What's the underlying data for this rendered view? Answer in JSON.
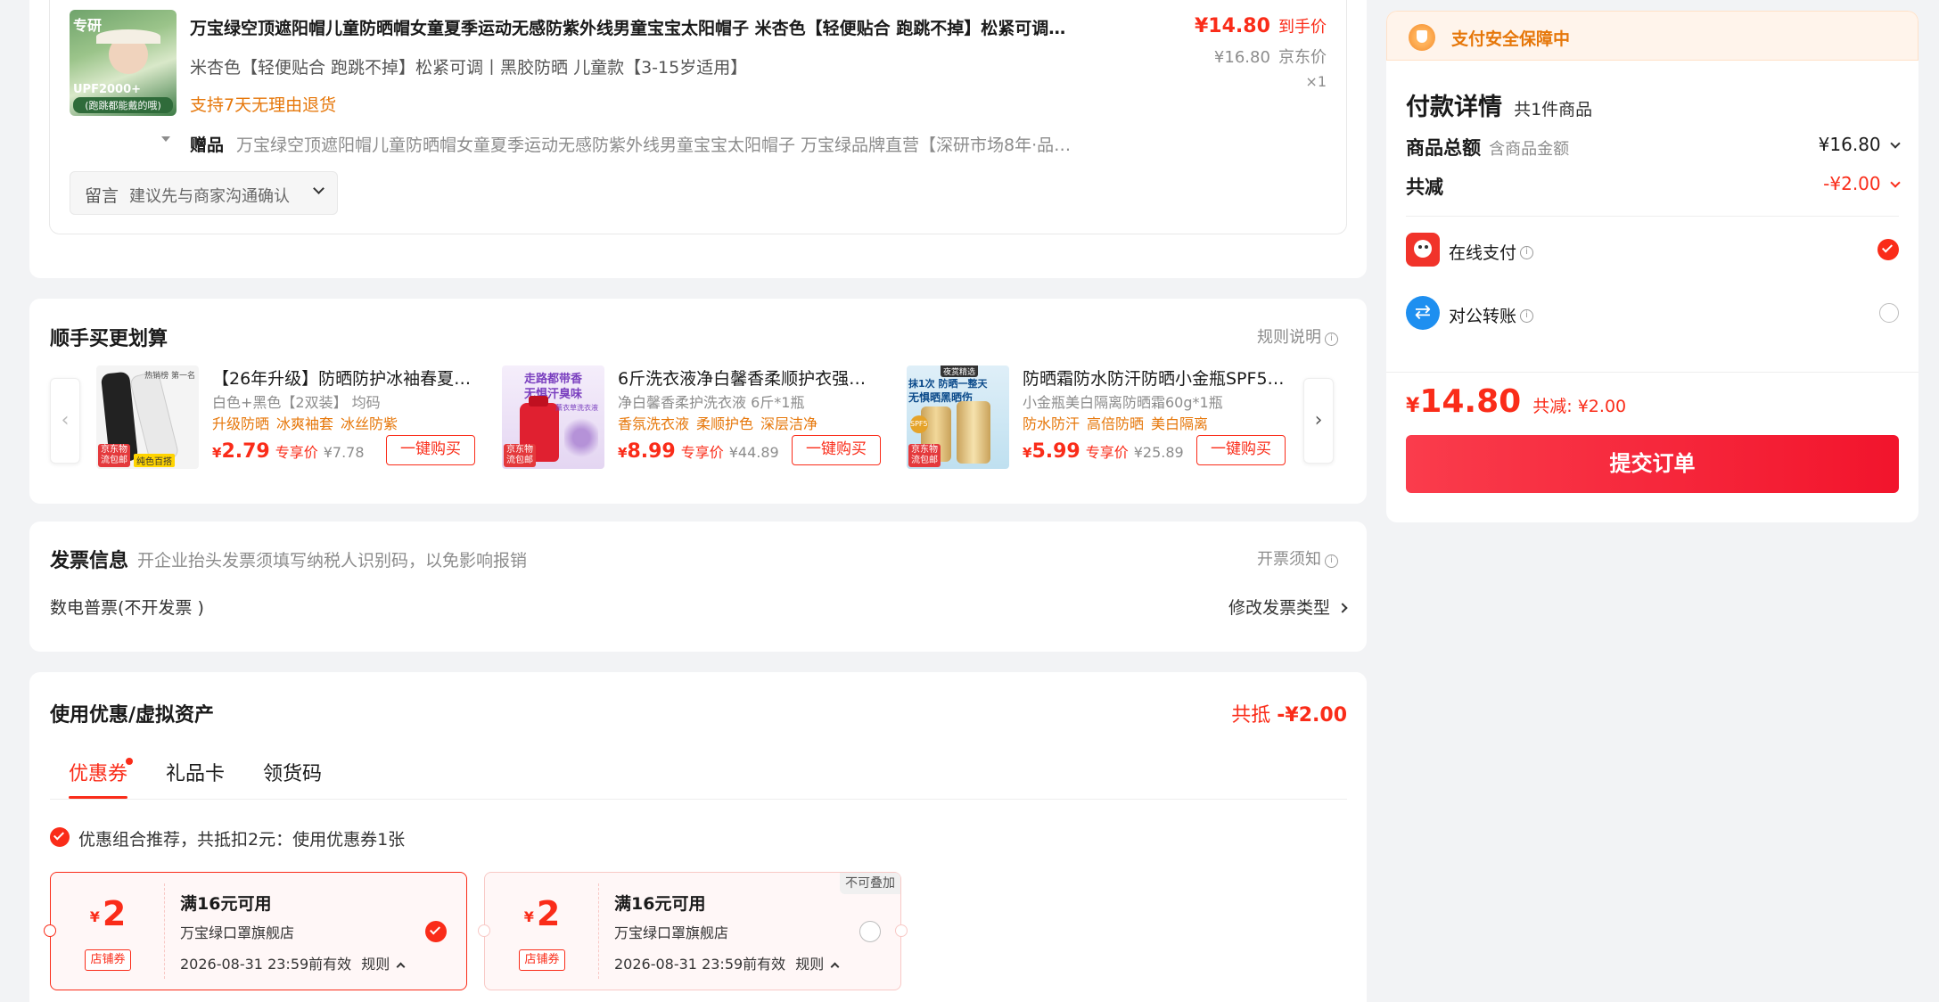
{
  "order": {
    "product_title": "万宝绿空顶遮阳帽儿童防晒帽女童夏季运动无感防紫外线男童宝宝太阳帽子 米杏色【轻便贴合 跑跳不掉】松紧可调…",
    "product_spec": "米杏色【轻便贴合 跑跳不掉】松紧可调丨黑胶防晒  儿童款【3-15岁适用】",
    "return_policy": "支持7天无理由退货",
    "price_paid": "¥14.80",
    "price_paid_label": "到手价",
    "price_jd": "¥16.80",
    "price_jd_label": "京东价",
    "quantity": "×1",
    "gift_label": "赠品",
    "gift_text": "万宝绿空顶遮阳帽儿童防晒帽女童夏季运动无感防紫外线男童宝宝太阳帽子 万宝绿品牌直营【深研市场8年·品…",
    "thumb_caption": "(跑跳都能戴的哦)",
    "thumb_badge": "UPF2000+",
    "thumb_top": "专研",
    "message_label": "留言",
    "message_placeholder": "建议先与商家沟通确认"
  },
  "buymore": {
    "title": "顺手买更划算",
    "rules_link": "规则说明",
    "products": [
      {
        "name": "【26年升级】防晒防护冰袖春夏…",
        "spec": "白色+黑色【2双装】 均码",
        "tags": [
          "升级防晒",
          "冰爽袖套",
          "冰丝防紫"
        ],
        "price_symbol": "¥",
        "price": "2.79",
        "price_label": "专享价",
        "orig_price": "¥7.78",
        "buy_label": "一键购买",
        "img_badge": "京东物流包邮",
        "img_badge2": "纯色百搭",
        "img_top": "热销榜 第一名"
      },
      {
        "name": "6斤洗衣液净白馨香柔顺护衣强力…",
        "spec": "净白馨香柔护洗衣液 6斤*1瓶",
        "tags": [
          "香氛洗衣液",
          "柔顺护色",
          "深层洁净"
        ],
        "price_symbol": "¥",
        "price": "8.99",
        "price_label": "专享价",
        "orig_price": "¥44.89",
        "buy_label": "一键购买",
        "img_badge": "京东物流包邮",
        "img_top": "走路都带香",
        "img_top2": "无惧汗臭味",
        "img_mid": "薰衣草洗衣液"
      },
      {
        "name": "防晒霜防水防汗防晒小金瓶SPF5…",
        "spec": "小金瓶美白隔离防晒霜60g*1瓶",
        "tags": [
          "防水防汗",
          "高倍防晒",
          "美白隔离"
        ],
        "price_symbol": "¥",
        "price": "5.99",
        "price_label": "专享价",
        "orig_price": "¥25.89",
        "buy_label": "一键购买",
        "img_badge": "京东物流包邮",
        "img_top": "抹1次 防晒一整天",
        "img_top2": "无惧晒黑晒伤",
        "img_corner": "夜赏精选",
        "img_spf": "SPF50+"
      }
    ],
    "prev_icon": "chevron-left-icon",
    "next_icon": "chevron-right-icon"
  },
  "invoice": {
    "title": "发票信息",
    "hint": "开企业抬头发票须填写纳税人识别码，以免影响报销",
    "notice_link": "开票须知",
    "current_type": "数电普票(不开发票 )",
    "modify_link": "修改发票类型"
  },
  "coupon": {
    "title": "使用优惠/虚拟资产",
    "total_label": "共抵",
    "total_value": "-¥2.00",
    "tabs": [
      "优惠券",
      "礼品卡",
      "领货码"
    ],
    "recommend_text": "优惠组合推荐，共抵扣2元：使用优惠券1张",
    "cards": [
      {
        "currency": "¥",
        "amount": "2",
        "type": "店铺券",
        "condition": "满16元可用",
        "shop": "万宝绿口罩旗舰店",
        "expiry": "2026-08-31 23:59前有效",
        "rules": "规则",
        "selected": true
      },
      {
        "currency": "¥",
        "amount": "2",
        "type": "店铺券",
        "condition": "满16元可用",
        "shop": "万宝绿口罩旗舰店",
        "expiry": "2026-08-31 23:59前有效",
        "rules": "规则",
        "selected": false,
        "badge": "不可叠加"
      }
    ]
  },
  "payment": {
    "security_text": "支付安全保障中",
    "title": "付款详情",
    "item_count": "共1件商品",
    "total_label": "商品总额",
    "total_sublabel": "含商品金额",
    "total_value": "¥16.80",
    "discount_label": "共减",
    "discount_value": "-¥2.00",
    "methods": [
      {
        "label": "在线支付",
        "icon": "jd-pay-icon",
        "selected": true
      },
      {
        "label": "对公转账",
        "icon": "transfer-icon",
        "selected": false
      }
    ],
    "final_symbol": "¥",
    "final_amount": "14.80",
    "final_discount": "共减: ¥2.00",
    "submit_label": "提交订单"
  },
  "colors": {
    "accent": "#fa2c19",
    "orange": "#e6770a",
    "security_bg": "#fff4eb",
    "page_bg": "#f2f3f5"
  }
}
